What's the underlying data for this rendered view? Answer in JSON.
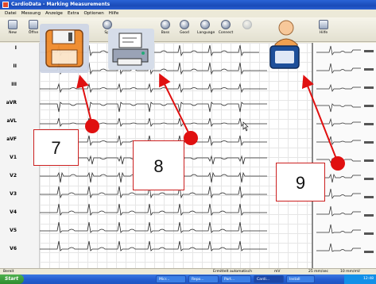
{
  "window": {
    "title": "CardioData - Marking Measurements"
  },
  "menu": [
    "Datei",
    "Messung",
    "Anzeige",
    "Extra",
    "Optionen",
    "Hilfe"
  ],
  "toolbar": [
    {
      "label": "New"
    },
    {
      "label": "Öffne"
    },
    {
      "label": "Sp."
    },
    {
      "label": "Bass"
    },
    {
      "label": "Good"
    },
    {
      "label": "Language"
    },
    {
      "label": "Connect"
    },
    {
      "label": "Hilfe"
    }
  ],
  "leads": [
    "I",
    "II",
    "III",
    "aVR",
    "aVL",
    "aVF",
    "V1",
    "V2",
    "V3",
    "V4",
    "V5",
    "V6"
  ],
  "callouts": [
    "7",
    "8",
    "9"
  ],
  "icons": [
    "floppy-save-icon",
    "printer-icon",
    "patient-icon"
  ],
  "status": {
    "left": "Bereit",
    "mid": "Ermittelt automatisch",
    "code": "mV",
    "speed": "25 mm/sec",
    "gain": "10 mm/mV"
  },
  "taskbar": {
    "start": "Start",
    "items": [
      "Micr...",
      "Repo...",
      "Part...",
      "Cardi...",
      "Install"
    ],
    "clock": "12:48"
  },
  "colors": {
    "accent_red": "#e01010",
    "titlebar": "#1a4bb8"
  }
}
